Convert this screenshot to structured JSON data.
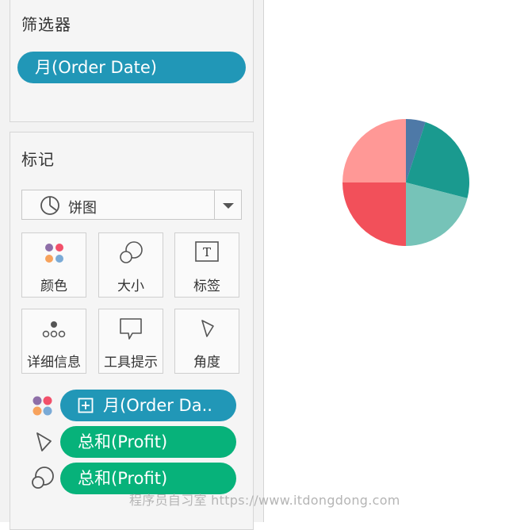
{
  "filters": {
    "title": "筛选器",
    "pill_label": "月(Order Date)"
  },
  "marks": {
    "title": "标记",
    "mark_type": "饼图",
    "buttons": [
      {
        "label": "颜色",
        "icon": "color-dots-icon"
      },
      {
        "label": "大小",
        "icon": "size-circles-icon"
      },
      {
        "label": "标签",
        "icon": "text-label-icon"
      },
      {
        "label": "详细信息",
        "icon": "detail-dots-icon"
      },
      {
        "label": "工具提示",
        "icon": "tooltip-icon"
      },
      {
        "label": "角度",
        "icon": "angle-icon"
      }
    ],
    "shelf": [
      {
        "icon": "color-dots-icon",
        "label": "月(Order Da..",
        "color": "#2197b7"
      },
      {
        "icon": "angle-icon",
        "label": "总和(Profit)",
        "color": "#07b27a"
      },
      {
        "icon": "size-circles-icon",
        "label": "总和(Profit)",
        "color": "#07b27a"
      }
    ]
  },
  "watermark": "程序员自习室 https://www.itdongdong.com",
  "chart_data": {
    "type": "pie",
    "values": [
      5,
      24,
      21,
      25,
      25
    ],
    "colors": [
      "#4e79a7",
      "#1a9a8f",
      "#76c3b8",
      "#f2505a",
      "#ff9896"
    ]
  }
}
